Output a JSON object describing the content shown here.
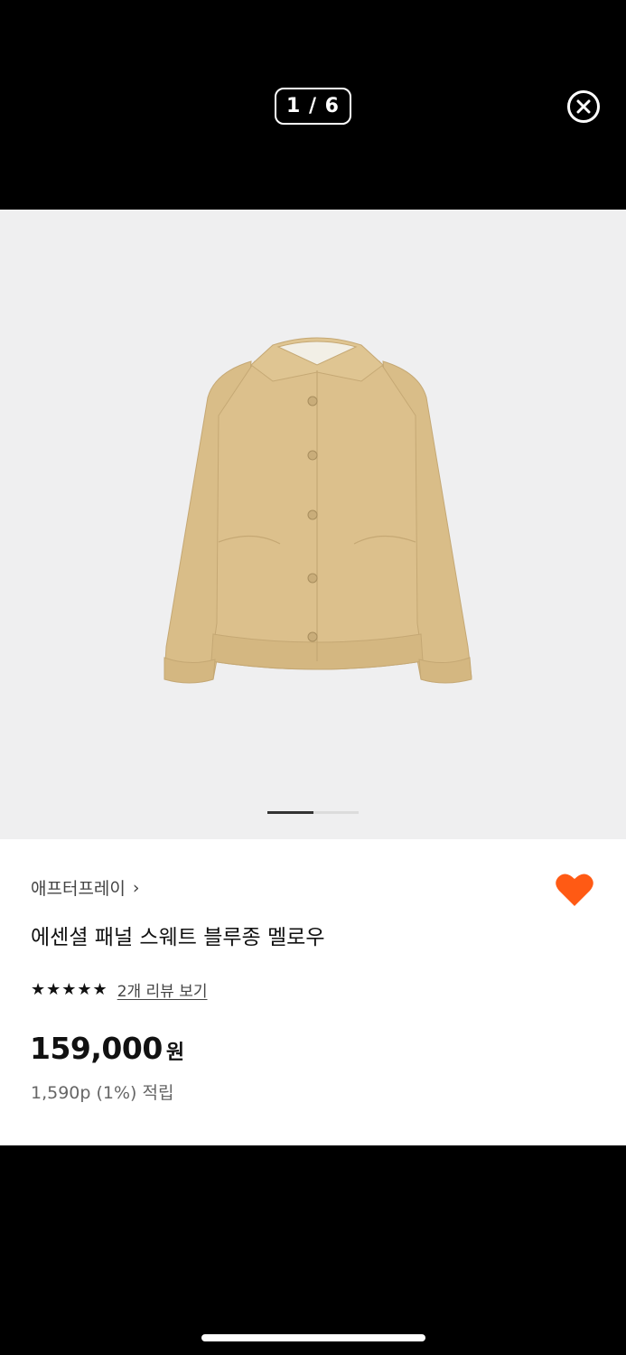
{
  "viewer": {
    "counter": "1 / 6"
  },
  "product": {
    "brand": "애프터프레이",
    "brand_chevron": "›",
    "name": "에센셜 패널 스웨트 블루종 멜로우",
    "stars": "★★★★★",
    "rating": 5,
    "review_link": "2개 리뷰 보기",
    "price": "159,000",
    "currency": "원",
    "points": "1,590p (1%) 적립"
  },
  "colors": {
    "heart": "#ff5a14",
    "background": "#efeff0",
    "jacket": "#dcc08c"
  },
  "icons": {
    "close": "close-circle-icon",
    "wishlist": "heart-icon"
  }
}
